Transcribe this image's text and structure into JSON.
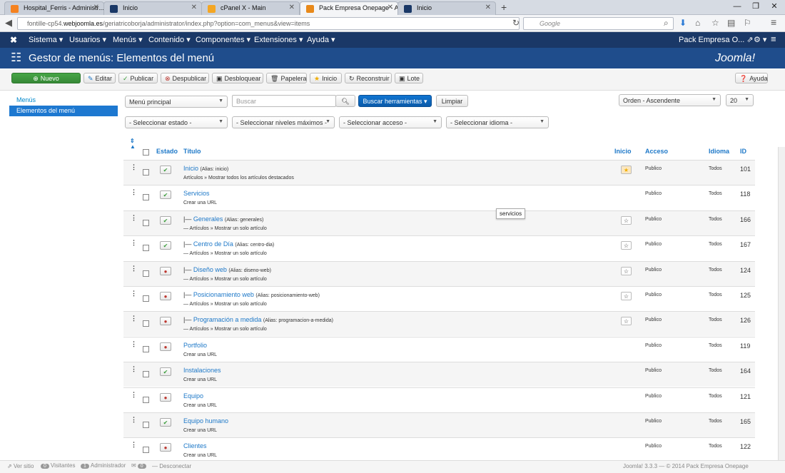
{
  "browser": {
    "tabs": [
      {
        "label": "Hospital_Ferris - Administr...",
        "color": "#f58220"
      },
      {
        "label": "Inicio",
        "color": "#1a3867"
      },
      {
        "label": "cPanel X - Main",
        "color": "#f4a623"
      },
      {
        "label": "Pack Empresa Onepage - A...",
        "color": "#e8891a"
      },
      {
        "label": "Inicio",
        "color": "#1a3867"
      }
    ],
    "url_prefix": "fontille-cp54.",
    "url_domain": "webjoomla.es",
    "url_rest": "/geriatricoborja/administrator/index.php?option=com_menus&view=items",
    "search_placeholder": "Google"
  },
  "topmenu": {
    "items": [
      "Sistema ▾",
      "Usuarios ▾",
      "Menús ▾",
      "Contenido ▾",
      "Componentes ▾",
      "Extensiones ▾",
      "Ayuda ▾"
    ],
    "site_name": "Pack Empresa O... ⇗",
    "settings": "⚙ ▾"
  },
  "header": {
    "title": "Gestor de menús: Elementos del menú",
    "logo": "Joomla!"
  },
  "toolbar": {
    "new": "Nuevo",
    "edit": "Editar",
    "publish": "Publicar",
    "unpublish": "Despublicar",
    "checkin": "Desbloquear",
    "trash": "Papelera",
    "home": "Inicio",
    "rebuild": "Reconstruir",
    "batch": "Lote",
    "help": "Ayuda"
  },
  "sidebar": {
    "items": [
      "Menús",
      "Elementos del menú"
    ]
  },
  "filters": {
    "menu": "Menú principal",
    "search_placeholder": "Buscar",
    "search_tools": "Buscar herramientas ▾",
    "clear": "Limpiar",
    "order": "Orden - Ascendente",
    "limit": "20",
    "state": "- Seleccionar estado -",
    "levels": "- Seleccionar niveles máximos -",
    "access": "- Seleccionar acceso -",
    "language": "- Seleccionar idioma -"
  },
  "columns": {
    "status": "Estado",
    "title": "Título",
    "home": "Inicio",
    "access": "Acceso",
    "language": "Idioma",
    "id": "ID"
  },
  "rows": [
    {
      "prefix": "",
      "title": "Inicio",
      "alias": "(Alias: inicio)",
      "sub": "Artículos » Mostrar todos los artículos destacados",
      "published": true,
      "home": "default",
      "access": "Publico",
      "lang": "Todos",
      "id": "101"
    },
    {
      "prefix": "",
      "title": "Servicios",
      "alias": "",
      "sub": "Crear una URL",
      "published": true,
      "home": "none",
      "access": "Publico",
      "lang": "Todos",
      "id": "118"
    },
    {
      "prefix": "|— ",
      "title": "Generales",
      "alias": "(Alias: generales)",
      "sub": "— Artículos » Mostrar un solo artículo",
      "published": true,
      "home": "star",
      "access": "Publico",
      "lang": "Todos",
      "id": "166"
    },
    {
      "prefix": "|— ",
      "title": "Centro de Día",
      "alias": "(Alias: centro-dia)",
      "sub": "— Artículos » Mostrar un solo artículo",
      "published": true,
      "home": "star",
      "access": "Publico",
      "lang": "Todos",
      "id": "167"
    },
    {
      "prefix": "|— ",
      "title": "Diseño web",
      "alias": "(Alias: diseno-web)",
      "sub": "— Artículos » Mostrar un solo artículo",
      "published": false,
      "home": "star",
      "access": "Publico",
      "lang": "Todos",
      "id": "124"
    },
    {
      "prefix": "|— ",
      "title": "Posicionamiento web",
      "alias": "(Alias: posicionamiento-web)",
      "sub": "— Artículos » Mostrar un solo artículo",
      "published": false,
      "home": "star",
      "access": "Publico",
      "lang": "Todos",
      "id": "125"
    },
    {
      "prefix": "|— ",
      "title": "Programación a medida",
      "alias": "(Alias: programacion-a-medida)",
      "sub": "— Artículos » Mostrar un solo artículo",
      "published": false,
      "home": "star",
      "access": "Publico",
      "lang": "Todos",
      "id": "126"
    },
    {
      "prefix": "",
      "title": "Portfolio",
      "alias": "",
      "sub": "Crear una URL",
      "published": false,
      "home": "none",
      "access": "Publico",
      "lang": "Todos",
      "id": "119"
    },
    {
      "prefix": "",
      "title": "Instalaciones",
      "alias": "",
      "sub": "Crear una URL",
      "published": true,
      "home": "none",
      "access": "Publico",
      "lang": "Todos",
      "id": "164"
    },
    {
      "prefix": "",
      "title": "Equipo",
      "alias": "",
      "sub": "Crear una URL",
      "published": false,
      "home": "none",
      "access": "Publico",
      "lang": "Todos",
      "id": "121"
    },
    {
      "prefix": "",
      "title": "Equipo humano",
      "alias": "",
      "sub": "Crear una URL",
      "published": true,
      "home": "none",
      "access": "Publico",
      "lang": "Todos",
      "id": "165"
    },
    {
      "prefix": "",
      "title": "Clientes",
      "alias": "",
      "sub": "Crear una URL",
      "published": false,
      "home": "none",
      "access": "Publico",
      "lang": "Todos",
      "id": "122"
    }
  ],
  "tooltip": "servicios",
  "statusbar": {
    "view_site": "Ver sitio",
    "visitors_count": "0",
    "visitors": "Visitantes",
    "admins_count": "1",
    "admins": "Administrador",
    "messages_count": "0",
    "logout": "Desconectar",
    "version": "Joomla! 3.3.3 — © 2014 Pack Empresa Onepage"
  }
}
